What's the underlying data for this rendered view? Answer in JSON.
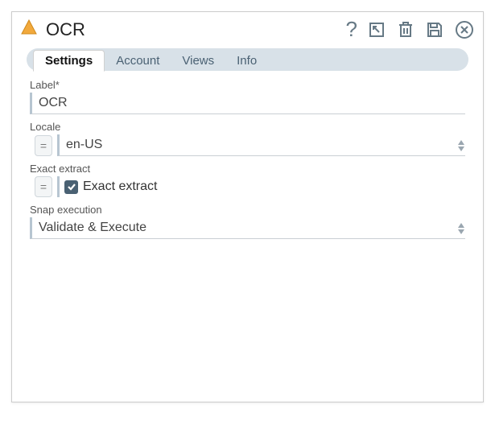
{
  "header": {
    "title": "OCR"
  },
  "tabs": [
    {
      "label": "Settings",
      "active": true
    },
    {
      "label": "Account",
      "active": false
    },
    {
      "label": "Views",
      "active": false
    },
    {
      "label": "Info",
      "active": false
    }
  ],
  "form": {
    "label_field": {
      "label": "Label*",
      "value": "OCR"
    },
    "locale_field": {
      "label": "Locale",
      "value": "en-US",
      "eq": "="
    },
    "exact_field": {
      "label": "Exact extract",
      "checkbox_label": "Exact extract",
      "eq": "="
    },
    "snap_exec": {
      "label": "Snap execution",
      "value": "Validate & Execute"
    }
  },
  "icons": {
    "help": "?"
  }
}
